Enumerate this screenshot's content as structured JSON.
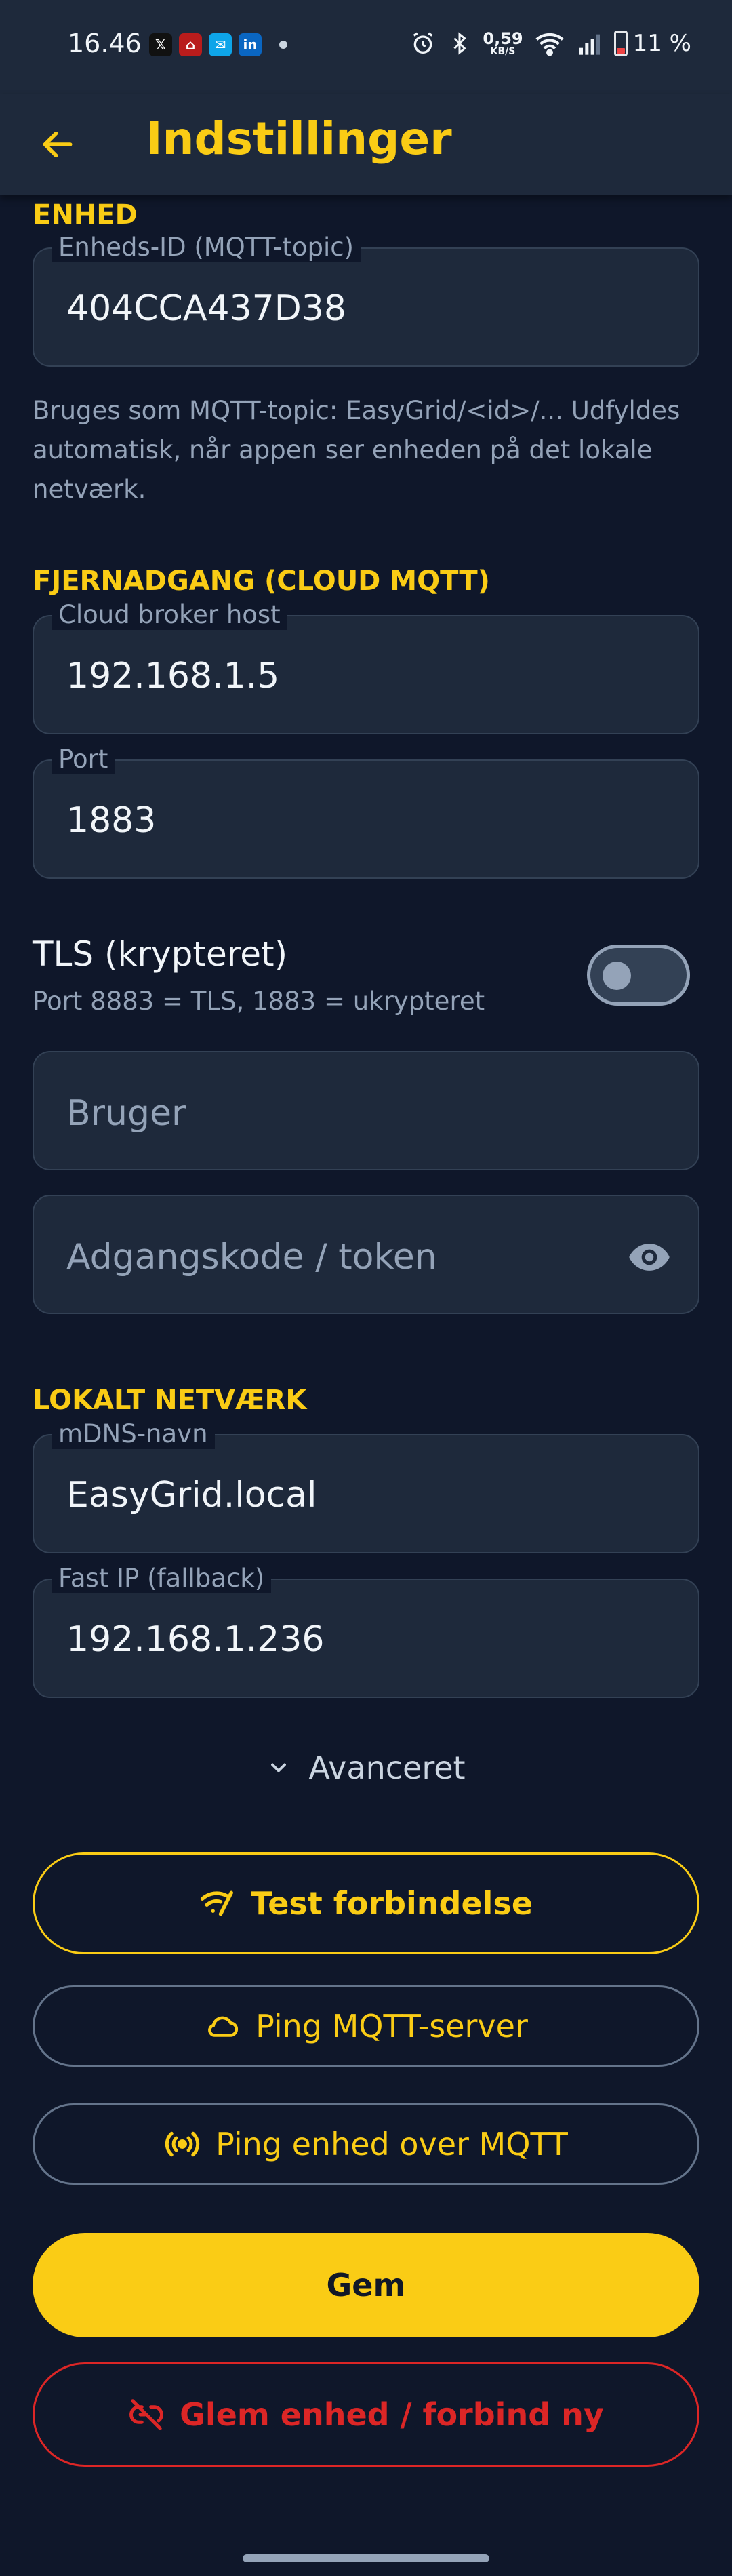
{
  "status_bar": {
    "time": "16.46",
    "apps": [
      {
        "icon": "x-icon",
        "glyph": "𝕏",
        "color": "#111111"
      },
      {
        "icon": "home-icon",
        "glyph": "⌂",
        "color": "#b91c1c"
      },
      {
        "icon": "message-icon",
        "glyph": "✉",
        "color": "#0ea5e9"
      },
      {
        "icon": "linkedin-icon",
        "glyph": "in",
        "color": "#0a66c2"
      }
    ],
    "net_speed": "0,59",
    "net_unit": "KB/S",
    "battery": "11 %"
  },
  "app_bar": {
    "title": "Indstillinger",
    "back_icon": "arrow-left-icon"
  },
  "device": {
    "section_title": "ENHED",
    "id_label": "Enheds-ID (MQTT-topic)",
    "id_value": "404CCA437D38",
    "helper": "Bruges som MQTT-topic: EasyGrid/<id>/... Udfyldes automatisk, når appen ser enheden på det lokale netværk."
  },
  "remote": {
    "section_title": "FJERNADGANG (CLOUD MQTT)",
    "host_label": "Cloud broker host",
    "host_value": "192.168.1.5",
    "port_label": "Port",
    "port_value": "1883",
    "tls_title": "TLS (krypteret)",
    "tls_subtitle": "Port 8883 = TLS, 1883 = ukrypteret",
    "tls_enabled": false,
    "user_placeholder": "Bruger",
    "password_placeholder": "Adgangskode / token"
  },
  "local": {
    "section_title": "LOKALT NETVÆRK",
    "mdns_label": "mDNS-navn",
    "mdns_value": "EasyGrid.local",
    "ip_label": "Fast IP (fallback)",
    "ip_value": "192.168.1.236"
  },
  "advanced_label": "Avanceret",
  "buttons": {
    "test": "Test forbindelse",
    "ping_server": "Ping MQTT-server",
    "ping_device": "Ping enhed over MQTT",
    "save": "Gem",
    "forget": "Glem enhed / forbind ny"
  },
  "colors": {
    "accent": "#facc15",
    "background": "#0f172a",
    "surface": "#1e293b",
    "danger": "#dc2626"
  }
}
